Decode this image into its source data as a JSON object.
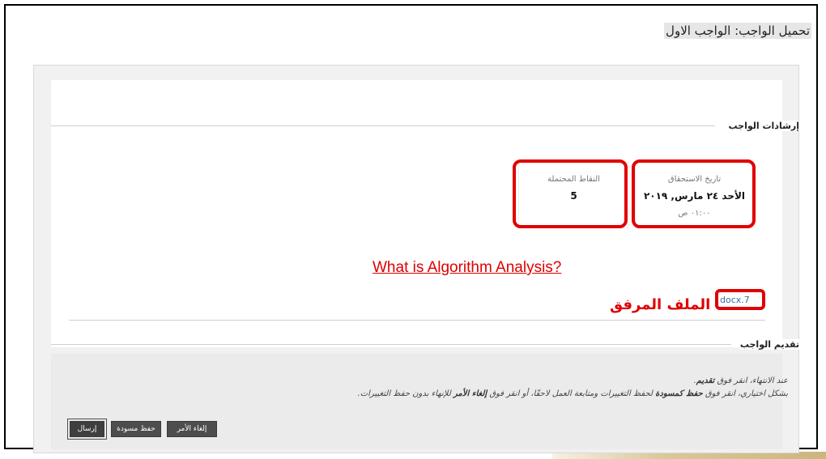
{
  "page": {
    "title": "تحميل الواجب: الواجب الاول"
  },
  "instructions": {
    "heading": "إرشادات الواجب"
  },
  "due": {
    "label": "تاريخ الاستحقاق",
    "date": "الأحد ٢٤ مارس, ٢٠١٩",
    "time": "٠١:٠٠ ص"
  },
  "points": {
    "label": "النقاط المحتملة",
    "value": "5"
  },
  "annotations": {
    "link_text": "What is Algorithm Analysis?",
    "attachment_label": "الملف المرفق",
    "highlight_color": "#e00000"
  },
  "attachment": {
    "file_name": "docx.7"
  },
  "submission": {
    "heading": "تقديم الواجب",
    "line1_prefix": "عند الانتهاء، انقر فوق ",
    "line1_bold": "تقديم",
    "line1_suffix": ".",
    "line2_prefix": "بشكل اختياري، انقر فوق ",
    "line2_bold1": "حفظ كمسودة",
    "line2_mid": " لحفظ التغييرات ومتابعة العمل لاحقًا، أو انقر فوق ",
    "line2_bold2": "إلغاء الأمر",
    "line2_suffix": " للإنهاء بدون حفظ التغييرات."
  },
  "buttons": {
    "cancel": "إلغاء الأمر",
    "save_draft": "حفظ مسودة",
    "submit": "إرسال"
  }
}
